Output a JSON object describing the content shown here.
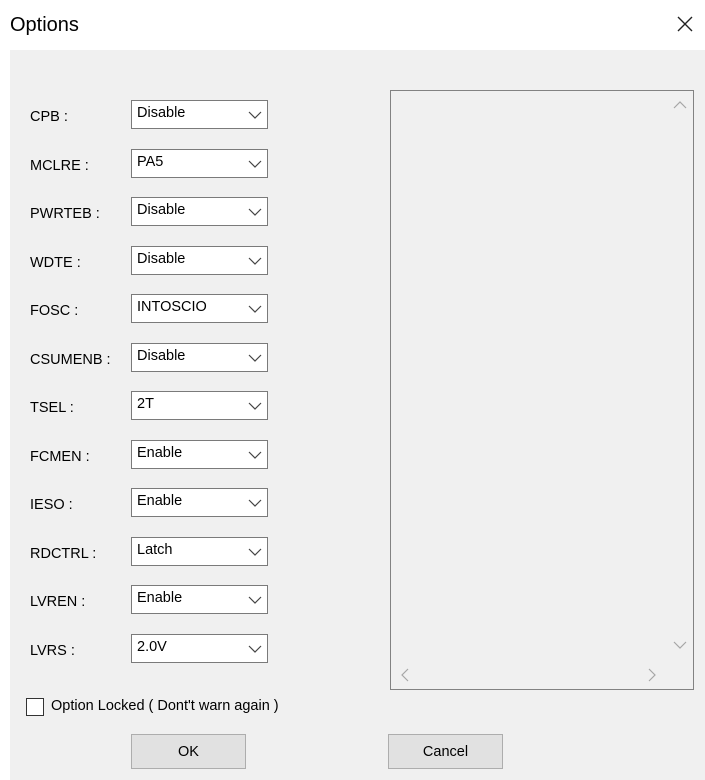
{
  "window": {
    "title": "Options"
  },
  "options": [
    {
      "label": "CPB :",
      "value": "Disable"
    },
    {
      "label": "MCLRE :",
      "value": "PA5"
    },
    {
      "label": "PWRTEB :",
      "value": "Disable"
    },
    {
      "label": "WDTE :",
      "value": "Disable"
    },
    {
      "label": "FOSC :",
      "value": "INTOSCIO"
    },
    {
      "label": "CSUMENB :",
      "value": "Disable"
    },
    {
      "label": "TSEL :",
      "value": "2T"
    },
    {
      "label": "FCMEN :",
      "value": "Enable"
    },
    {
      "label": "IESO :",
      "value": "Enable"
    },
    {
      "label": "RDCTRL :",
      "value": "Latch"
    },
    {
      "label": "LVREN :",
      "value": "Enable"
    },
    {
      "label": "LVRS :",
      "value": "2.0V"
    }
  ],
  "option_locked": {
    "label": "Option Locked ( Dont't warn again )",
    "checked": false
  },
  "buttons": {
    "ok": "OK",
    "cancel": "Cancel"
  },
  "icons": {
    "close": "close-icon",
    "dropdown": "chevron-down-icon",
    "scroll_up": "scroll-up-arrow-icon",
    "scroll_down": "scroll-down-arrow-icon",
    "scroll_left": "scroll-left-arrow-icon",
    "scroll_right": "scroll-right-arrow-icon"
  }
}
